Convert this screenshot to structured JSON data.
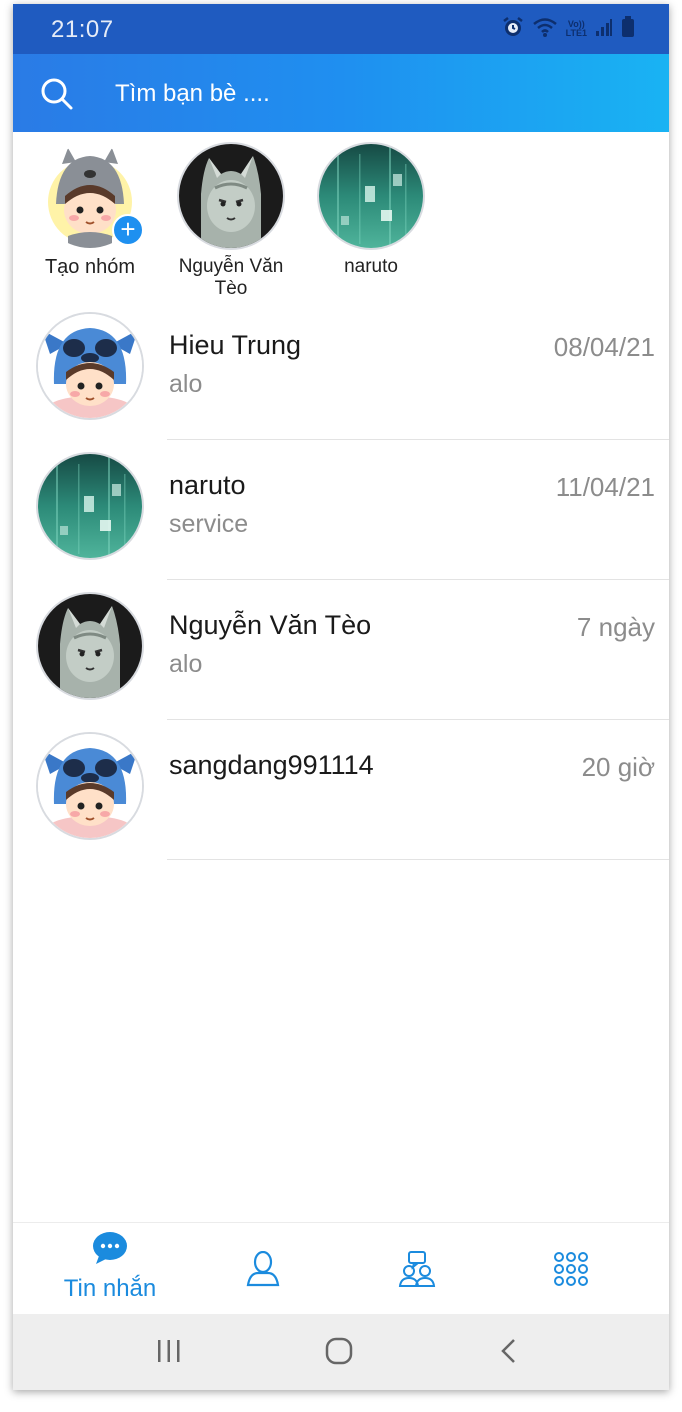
{
  "status": {
    "time": "21:07",
    "network_top": "Vo))",
    "network_bottom": "LTE1"
  },
  "search": {
    "placeholder": "Tìm bạn bè ....",
    "icon": "search-icon"
  },
  "stories": [
    {
      "label": "Tạo nhóm",
      "avatar": "totoro-boy",
      "badge": "+"
    },
    {
      "label": "Nguyễn Văn Tèo",
      "avatar": "wolf-sketch"
    },
    {
      "label": "naruto",
      "avatar": "teal-night"
    }
  ],
  "conversations": [
    {
      "name": "Hieu Trung",
      "preview": "alo",
      "time": "08/04/21",
      "avatar": "stitch-boy"
    },
    {
      "name": "naruto",
      "preview": "service",
      "time": "11/04/21",
      "avatar": "teal-night"
    },
    {
      "name": "Nguyễn Văn Tèo",
      "preview": "alo",
      "time": "7 ngày",
      "avatar": "wolf-sketch"
    },
    {
      "name": "sangdang991114",
      "preview": "",
      "time": "20 giờ",
      "avatar": "stitch-boy"
    }
  ],
  "tabs": [
    {
      "label": "Tin nhắn",
      "icon": "chat-bubble-icon",
      "active": true
    },
    {
      "label": "",
      "icon": "contact-icon",
      "active": false
    },
    {
      "label": "",
      "icon": "group-icon",
      "active": false
    },
    {
      "label": "",
      "icon": "apps-grid-icon",
      "active": false
    }
  ],
  "colors": {
    "accent": "#1b8bde",
    "header_start": "#2a7be6",
    "header_end": "#19b3f3",
    "status_bar": "#1f5bc0"
  }
}
